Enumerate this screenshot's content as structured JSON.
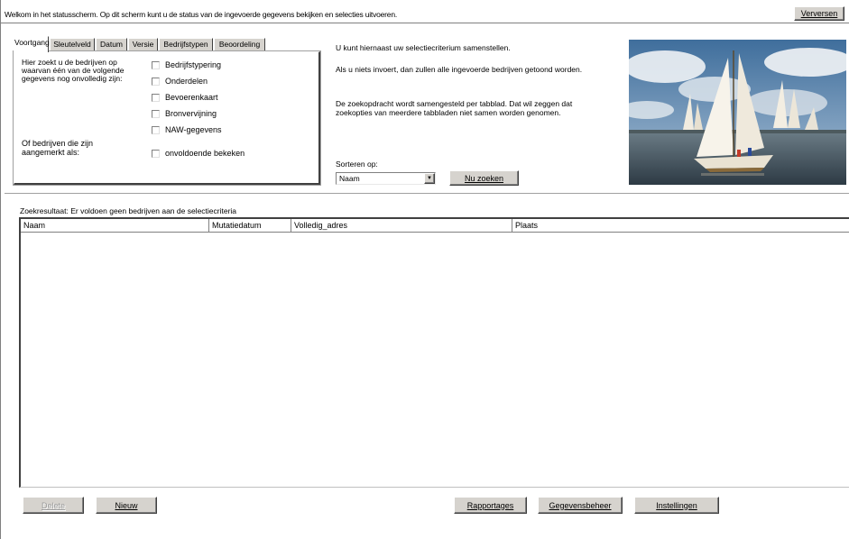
{
  "header": {
    "welcome_text": "Welkom in het statusscherm. Op dit scherm kunt u de status van de ingevoerde gegevens bekijken en selecties uitvoeren.",
    "refresh_button": "Verversen"
  },
  "tabs": [
    {
      "label": "Voortgang",
      "active": true
    },
    {
      "label": "Sleutelveld",
      "active": false
    },
    {
      "label": "Datum",
      "active": false
    },
    {
      "label": "Versie",
      "active": false
    },
    {
      "label": "Bedrijfstypen",
      "active": false
    },
    {
      "label": "Beoordeling",
      "active": false
    }
  ],
  "voortgang": {
    "intro_text": "Hier zoekt u de bedrijven op waarvan één van de volgende gegevens nog onvolledig zijn:",
    "options": [
      {
        "label": "Bedrijfstypering",
        "checked": false
      },
      {
        "label": "Onderdelen",
        "checked": false
      },
      {
        "label": "Bevoerenkaart",
        "checked": false
      },
      {
        "label": "Bronvervijning",
        "checked": false
      },
      {
        "label": "NAW-gegevens",
        "checked": false
      }
    ],
    "or_text": "Of bedrijven die zijn aangemerkt als:",
    "or_option": {
      "label": "onvoldoende bekeken",
      "checked": false
    }
  },
  "info": {
    "line1": "U kunt hiernaast uw selectiecriterium samenstellen.",
    "line2": "Als u niets invoert, dan zullen alle ingevoerde bedrijven getoond worden.",
    "line3": "De zoekopdracht wordt samengesteld per tabblad. Dat wil zeggen dat zoekopties van meerdere tabbladen niet samen worden genomen."
  },
  "sort": {
    "label": "Sorteren op:",
    "selected": "Naam",
    "search_button": "Nu zoeken"
  },
  "results": {
    "status_text": "Zoekresultaat: Er voldoen geen bedrijven aan de selectiecriteria",
    "columns": [
      "Naam",
      "Mutatiedatum",
      "Volledig_adres",
      "Plaats"
    ],
    "rows": []
  },
  "footer": {
    "delete_button": "Delete",
    "new_button": "Nieuw",
    "reports_button": "Rapportages",
    "data_button": "Gegevensbeheer",
    "settings_button": "Instellingen"
  },
  "colors": {
    "button_face": "#d6d3ce",
    "window_bg": "#ffffff",
    "frame_dark": "#404040"
  }
}
